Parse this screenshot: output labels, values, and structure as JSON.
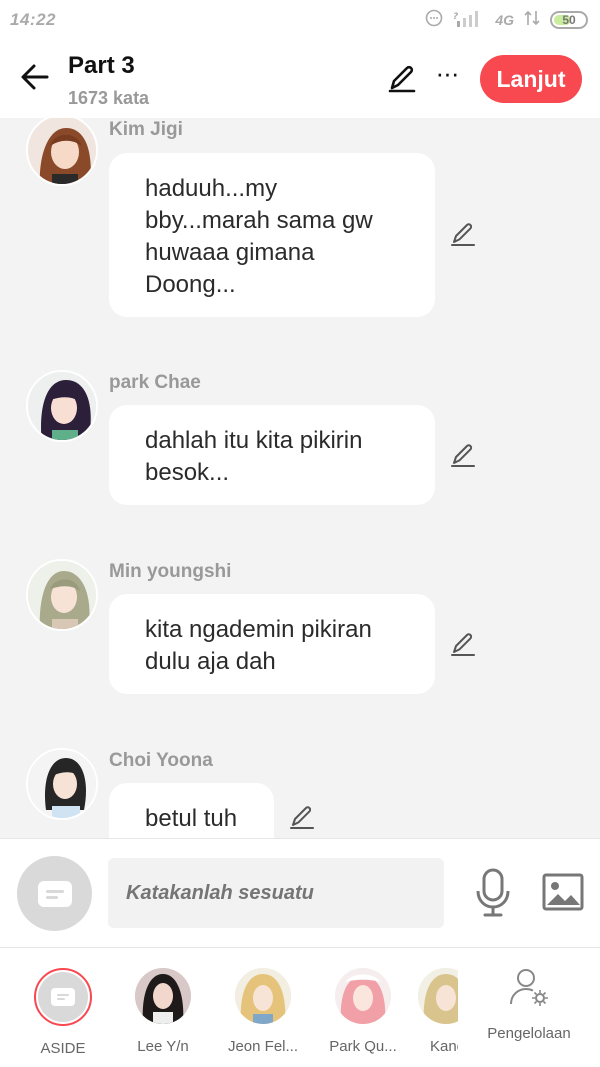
{
  "status_bar": {
    "time": "14:22",
    "network": "4G",
    "battery": "50",
    "battery_level": 0.5
  },
  "header": {
    "title": "Part 3",
    "subtitle": "1673 kata",
    "next_label": "Lanjut",
    "more_label": "···",
    "accent_color": "#f84850"
  },
  "messages": [
    {
      "sender": "Kim Jigi",
      "text": "haduuh...my bby...marah sama gw huwaaa gimana Doong..."
    },
    {
      "sender": "park Chae",
      "text": "dahlah itu kita pikirin besok..."
    },
    {
      "sender": "Min youngshi",
      "text": "kita ngademin pikiran dulu aja dah"
    },
    {
      "sender": "Choi Yoona",
      "text": "betul tuh"
    }
  ],
  "input": {
    "placeholder": "Katakanlah sesuatu"
  },
  "characters": [
    {
      "label": "ASIDE"
    },
    {
      "label": "Lee Y/n"
    },
    {
      "label": "Jeon Fel..."
    },
    {
      "label": "Park Qu..."
    },
    {
      "label": "Kang"
    }
  ],
  "manage_label": "Pengelolaan",
  "icons": {
    "back": "arrow-left-icon",
    "edit": "pencil-icon",
    "more": "more-dots-icon",
    "aside": "chat-bubble-icon",
    "mic": "microphone-icon",
    "image": "image-icon",
    "manage": "user-settings-icon"
  }
}
